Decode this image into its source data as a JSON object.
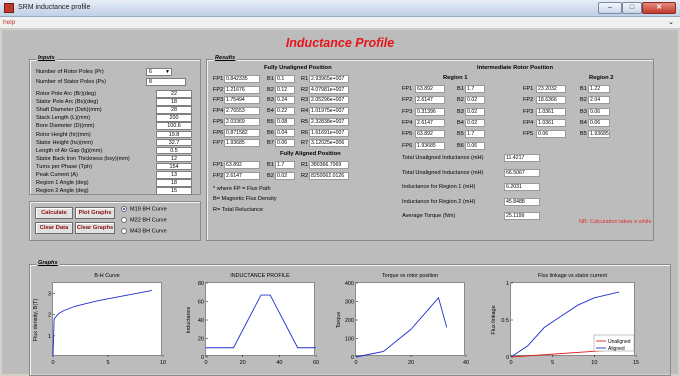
{
  "window": {
    "title": "SRM inductance profile"
  },
  "menu": {
    "help": "help"
  },
  "app_title": "Inductance Profile",
  "inputs": {
    "label": "Inputs",
    "rotor_poles": {
      "label": "Number of Rotor Poles (Pr)",
      "value": "6"
    },
    "stator_poles": {
      "label": "Number of Stator Poles (Ps)",
      "value": "8"
    },
    "rows": [
      {
        "label": "Rotor Pole Arc (Br)(deg)",
        "value": "22"
      },
      {
        "label": "Stator Pole Arc (Bs)(deg)",
        "value": "18"
      },
      {
        "label": "Shaft Diameter (Dsh)(mm)",
        "value": "28"
      },
      {
        "label": "Stack Length (L)(mm)",
        "value": "200"
      },
      {
        "label": "Bore Diameter (D)(mm)",
        "value": "100.6"
      },
      {
        "label": "Rotor Height (hr)(mm)",
        "value": "19.8"
      },
      {
        "label": "Stator Height (hs)(mm)",
        "value": "32.7"
      },
      {
        "label": "Length of Air Gap (lg)(mm)",
        "value": "0.5"
      },
      {
        "label": "Stator Back Iron Thickness (bsy)(mm)",
        "value": "12"
      },
      {
        "label": "Turns per Phase (Tph)",
        "value": "154"
      },
      {
        "label": "Peak Current (A)",
        "value": "13"
      },
      {
        "label": "Region 1 Angle (deg)",
        "value": "18"
      },
      {
        "label": "Region 2 Angle (deg)",
        "value": "15"
      }
    ]
  },
  "actions": {
    "calculate": "Calculate",
    "plot_graphs": "Plot Graphs",
    "clear_data": "Clear Data",
    "clear_graphs": "Clear Graphs"
  },
  "curves": {
    "m19": "M19 BH Curve",
    "m22": "M22 BH Curve",
    "m43": "M43 BH Curve"
  },
  "results": {
    "label": "Results",
    "unaligned_title": "Fully Unaligned Position",
    "aligned_title": "Fully Aligned Position",
    "intermediate_title": "Intermediate Rotor Position",
    "region1_title": "Region 1",
    "region2_title": "Region 2",
    "unaligned": {
      "fp": [
        {
          "k": "FP1",
          "v": "0.842335"
        },
        {
          "k": "FP2",
          "v": "1.21676"
        },
        {
          "k": "FP3",
          "v": "1.75494"
        },
        {
          "k": "FP4",
          "v": "2.76553"
        },
        {
          "k": "FP5",
          "v": "2.03369"
        },
        {
          "k": "FP6",
          "v": "0.871582"
        },
        {
          "k": "FP7",
          "v": "1.93685"
        }
      ],
      "b": [
        {
          "k": "B1",
          "v": "0.1"
        },
        {
          "k": "B2",
          "v": "0.12"
        },
        {
          "k": "B3",
          "v": "0.24"
        },
        {
          "k": "B4",
          "v": "0.22"
        },
        {
          "k": "B5",
          "v": "0.08"
        },
        {
          "k": "B6",
          "v": "0.04"
        },
        {
          "k": "B7",
          "v": "0.06"
        }
      ],
      "r": [
        {
          "k": "R1",
          "v": "2.93965e+007"
        },
        {
          "k": "R2",
          "v": "4.07981e+007"
        },
        {
          "k": "R3",
          "v": "2.05296e+007"
        },
        {
          "k": "R4",
          "v": "1.01975e+007"
        },
        {
          "k": "R5",
          "v": "2.32838e+007"
        },
        {
          "k": "R6",
          "v": "1.61691e+007"
        },
        {
          "k": "R7",
          "v": "3.12025e+006"
        }
      ]
    },
    "aligned": {
      "fp": [
        {
          "k": "FP1",
          "v": "63.892"
        },
        {
          "k": "FP2",
          "v": "2.6147"
        }
      ],
      "b": [
        {
          "k": "B1",
          "v": "1.7"
        },
        {
          "k": "B2",
          "v": "0.02"
        }
      ],
      "r": [
        {
          "k": "R1",
          "v": "380366.7069"
        },
        {
          "k": "R2",
          "v": "8250062.0126"
        }
      ]
    },
    "region1": {
      "fp": [
        {
          "k": "FP1",
          "v": "63.892"
        },
        {
          "k": "FP2",
          "v": "2.6147"
        },
        {
          "k": "FP3",
          "v": "0.31396"
        },
        {
          "k": "FP4",
          "v": "2.6147"
        },
        {
          "k": "FP5",
          "v": "63.892"
        },
        {
          "k": "FP6",
          "v": "1.93685"
        }
      ],
      "b": [
        {
          "k": "B1",
          "v": "1.7"
        },
        {
          "k": "B2",
          "v": "0.02"
        },
        {
          "k": "B3",
          "v": "0.02"
        },
        {
          "k": "B4",
          "v": "0.02"
        },
        {
          "k": "B5",
          "v": "1.7"
        },
        {
          "k": "B6",
          "v": "0.06"
        }
      ]
    },
    "region2": {
      "fp": [
        {
          "k": "FP1",
          "v": "23.2032"
        },
        {
          "k": "FP2",
          "v": "18.6366"
        },
        {
          "k": "FP3",
          "v": "1.0361"
        },
        {
          "k": "FP4",
          "v": "1.0361"
        },
        {
          "k": "FP5",
          "v": "0.06"
        }
      ],
      "b": [
        {
          "k": "B1",
          "v": "1.22"
        },
        {
          "k": "B2",
          "v": "2.04"
        },
        {
          "k": "B3",
          "v": "0.06"
        },
        {
          "k": "B4",
          "v": "0.06"
        },
        {
          "k": "B5",
          "v": "1.93685"
        }
      ]
    },
    "legend": [
      "* where FP = Flux Path",
      "B= Magnetic Flux Density",
      "R= Total Reluctance"
    ],
    "totals": [
      {
        "label": "Total Unaligned Inductance (mH)",
        "value": "11.4217"
      },
      {
        "label": "Total Unaligned Inductance (mH)",
        "value": "66.5067"
      },
      {
        "label": "Inductance for Region 1 (mH)",
        "value": "6.2031"
      },
      {
        "label": "Inductance for Region 2 (mH)",
        "value": "45.8488"
      },
      {
        "label": "Average Torque (Nm)",
        "value": "25.1199"
      }
    ],
    "note": "NB: Calculation takes a while"
  },
  "graphs_label": "Graphs",
  "chart_data": [
    {
      "type": "line",
      "title": "B-H Curve",
      "xlabel": "",
      "ylabel": "Flux density, B(T)",
      "xlim": [
        0,
        10
      ],
      "ylim": [
        0,
        3.5
      ],
      "xticks": [
        "0",
        "5",
        "10"
      ],
      "yticks": [
        "1",
        "2",
        "3"
      ],
      "series": [
        {
          "x": [
            0,
            0.1,
            0.5,
            1,
            2,
            4,
            6,
            8,
            9
          ],
          "y": [
            0,
            1.8,
            2.05,
            2.2,
            2.4,
            2.65,
            2.85,
            3.05,
            3.15
          ]
        }
      ]
    },
    {
      "type": "line",
      "title": "INDUCTANCE PROFILE",
      "xlabel": "",
      "ylabel": "Inductance",
      "xlim": [
        0,
        60
      ],
      "ylim": [
        0,
        80
      ],
      "xticks": [
        "0",
        "20",
        "40",
        "60"
      ],
      "yticks": [
        "0",
        "20",
        "40",
        "60",
        "80"
      ],
      "series": [
        {
          "x": [
            0,
            15,
            30,
            35,
            50,
            60
          ],
          "y": [
            10,
            10,
            67,
            67,
            10,
            10
          ]
        }
      ]
    },
    {
      "type": "line",
      "title": "Torque vs rotor position",
      "xlabel": "",
      "ylabel": "Torque",
      "xlim": [
        0,
        40
      ],
      "ylim": [
        0,
        400
      ],
      "xticks": [
        "0",
        "20",
        "40"
      ],
      "yticks": [
        "0",
        "100",
        "200",
        "300",
        "400"
      ],
      "series": [
        {
          "x": [
            0,
            10,
            20,
            30,
            33
          ],
          "y": [
            0,
            30,
            150,
            320,
            160
          ]
        }
      ]
    },
    {
      "type": "line",
      "title": "Flux linkage vs stator current",
      "xlabel": "",
      "ylabel": "Flux linkage",
      "xlim": [
        0,
        15
      ],
      "ylim": [
        0,
        1
      ],
      "xticks": [
        "0",
        "5",
        "10",
        "15"
      ],
      "yticks": [
        "0",
        "0.5",
        "1"
      ],
      "series": [
        {
          "name": "Unaligned",
          "color": "#e02020",
          "x": [
            0,
            13
          ],
          "y": [
            0,
            0.1
          ]
        },
        {
          "name": "Aligned",
          "color": "#2030d0",
          "x": [
            0,
            2,
            4,
            6,
            8,
            10,
            13
          ],
          "y": [
            0,
            0.15,
            0.4,
            0.55,
            0.7,
            0.8,
            0.88
          ]
        }
      ]
    }
  ]
}
